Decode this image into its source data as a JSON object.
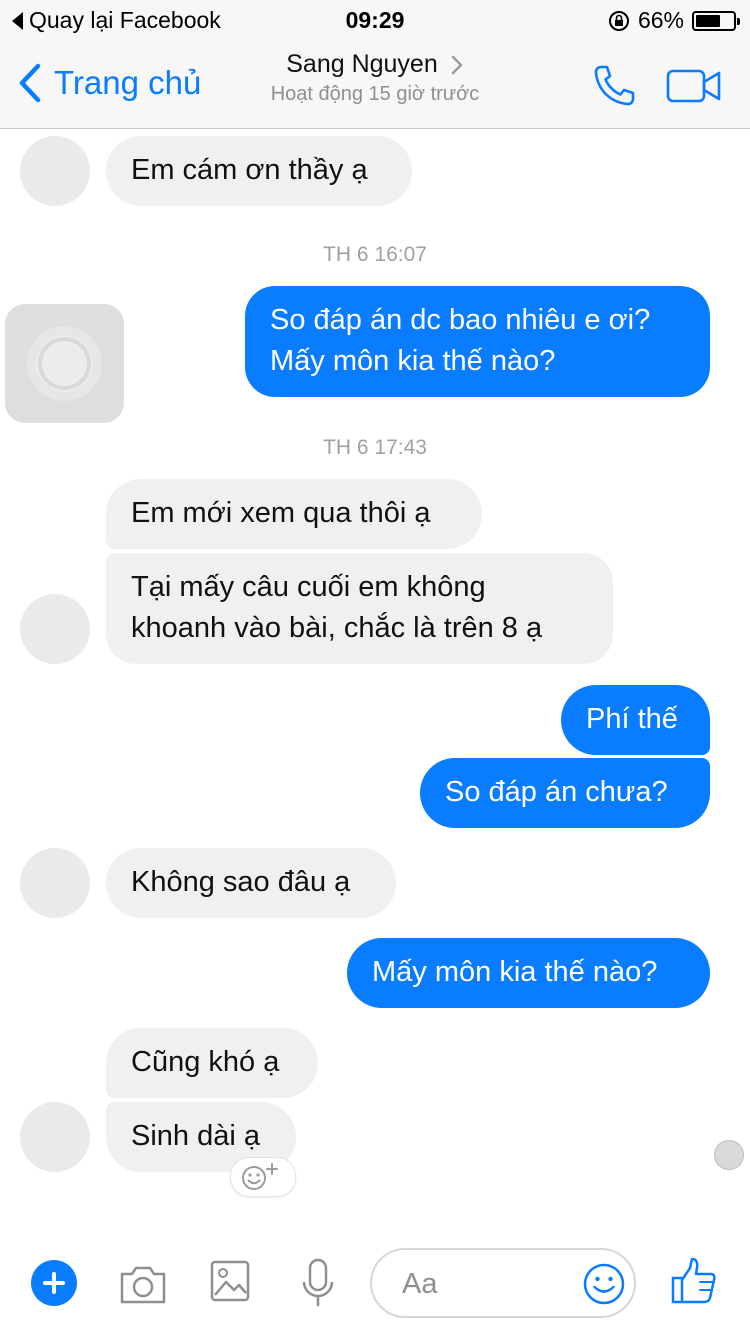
{
  "status_bar": {
    "back_app": "Quay lại Facebook",
    "time": "09:29",
    "battery": "66%",
    "battery_level": 0.66
  },
  "nav": {
    "back_label": "Trang chủ",
    "contact_name": "Sang Nguyen",
    "active_status": "Hoạt động 15 giờ trước"
  },
  "chat": {
    "timestamps": [
      "TH 6 16:07",
      "TH 6 17:43"
    ],
    "messages": [
      {
        "from": "them",
        "text": "Em cám ơn thầy ạ"
      },
      {
        "from": "me",
        "text": "So đáp án dc bao nhiêu e ơi? Mấy môn kia thế nào?"
      },
      {
        "from": "them",
        "text": "Em mới xem qua thôi ạ"
      },
      {
        "from": "them",
        "text": "Tại mấy câu cuối em không khoanh vào bài, chắc là trên 8 ạ"
      },
      {
        "from": "me",
        "text": "Phí thế"
      },
      {
        "from": "me",
        "text": "So đáp án chưa?"
      },
      {
        "from": "them",
        "text": "Không sao đâu ạ"
      },
      {
        "from": "me",
        "text": "Mấy môn kia thế nào?"
      },
      {
        "from": "them",
        "text": "Cũng khó ạ"
      },
      {
        "from": "them",
        "text": "Sinh dài ạ"
      }
    ]
  },
  "composer": {
    "placeholder": "Aa"
  },
  "colors": {
    "accent": "#0a7cff",
    "incoming_bubble": "#f1f0f0",
    "bar_background": "#f7f7f7"
  },
  "icons": [
    "back-triangle-icon",
    "lock-rotation-icon",
    "battery-icon",
    "chevron-left-icon",
    "chevron-right-icon",
    "phone-icon",
    "video-camera-icon",
    "add-icon",
    "camera-icon",
    "image-icon",
    "microphone-icon",
    "emoji-icon",
    "thumbs-up-icon",
    "add-reaction-icon"
  ]
}
